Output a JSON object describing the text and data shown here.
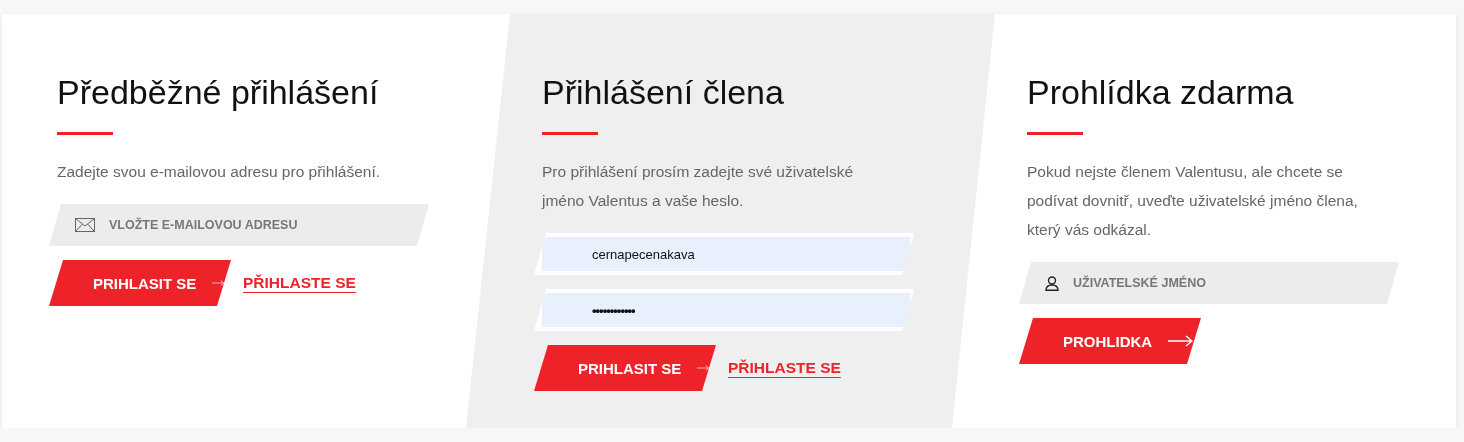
{
  "panels": [
    {
      "title": "Předběžné přihlášení",
      "shaded": false,
      "description": "Zadejte svou e-mailovou adresu pro přihlášení.",
      "fields": [
        {
          "kind": "email",
          "placeholder": "VLOŽTE E-MAILOVOU ADRESU"
        }
      ],
      "button": "PRIHLASIT SE",
      "link": "PŘIHLASTE SE"
    },
    {
      "title": "Přihlášení člena",
      "shaded": true,
      "description": "Pro přihlášení prosím zadejte své uživatelské jméno Valentus a vaše heslo.",
      "fields": [
        {
          "kind": "text",
          "value": "cernapecenakava"
        },
        {
          "kind": "password",
          "value": "••••••••••••"
        }
      ],
      "button": "PRIHLASIT SE",
      "link": "PŘIHLASTE SE"
    },
    {
      "title": "Prohlídka zdarma",
      "shaded": false,
      "description": "Pokud nejste členem Valentusu, ale chcete se podívat dovnitř, uveďte uživatelské jméno člena, který vás odkázal.",
      "fields": [
        {
          "kind": "user",
          "placeholder": "UŽIVATELSKÉ JMÉNO"
        }
      ],
      "button": "PROHLIDKA"
    }
  ]
}
